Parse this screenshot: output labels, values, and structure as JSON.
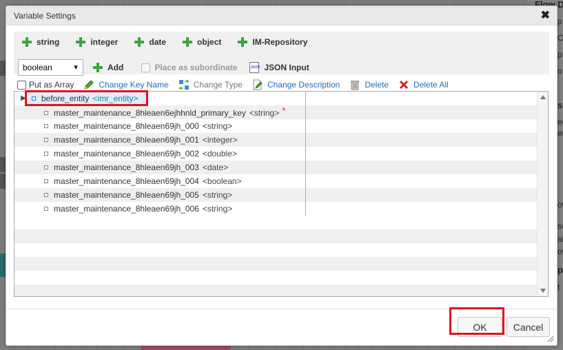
{
  "dialog": {
    "title": "Variable Settings",
    "close_symbol": "✖"
  },
  "toolbar": {
    "add_buttons": [
      {
        "label": "string",
        "icon": "plus-icon"
      },
      {
        "label": "integer",
        "icon": "plus-icon"
      },
      {
        "label": "date",
        "icon": "plus-icon"
      },
      {
        "label": "object",
        "icon": "plus-icon"
      },
      {
        "label": "IM-Repository",
        "icon": "plus-icon"
      }
    ],
    "type_select": {
      "value": "boolean"
    },
    "add_label": "Add",
    "place_subordinate_label": "Place as subordinate",
    "json_input_label": "JSON Input",
    "json_icon_text": "JSON"
  },
  "actions": {
    "put_as_array": "Put as Array",
    "change_key_name": "Change Key Name",
    "change_type": "Change Type",
    "change_description": "Change Description",
    "delete": "Delete",
    "delete_all": "Delete All"
  },
  "tree": {
    "root": {
      "name": "before_entity",
      "type": "<imr_entity>"
    },
    "children": [
      {
        "name": "master_maintenance_8hleaen6ejhhnld_primary_key",
        "type": "<string>",
        "required": "*"
      },
      {
        "name": "master_maintenance_8hleaen69jh_000",
        "type": "<string>"
      },
      {
        "name": "master_maintenance_8hleaen69jh_001",
        "type": "<integer>"
      },
      {
        "name": "master_maintenance_8hleaen69jh_002",
        "type": "<double>"
      },
      {
        "name": "master_maintenance_8hleaen69jh_003",
        "type": "<date>"
      },
      {
        "name": "master_maintenance_8hleaen69jh_004",
        "type": "<boolean>"
      },
      {
        "name": "master_maintenance_8hleaen69jh_005",
        "type": "<string>"
      },
      {
        "name": "master_maintenance_8hleaen69jh_006",
        "type": "<string>"
      }
    ]
  },
  "footer": {
    "ok_label": "OK",
    "cancel_label": "Cancel"
  },
  "background": {
    "top_right_title": "Flow D",
    "fragments": [
      "p",
      "C",
      "p",
      "o",
      "s",
      "ed",
      "en",
      "ow",
      "se",
      "ali",
      "ow",
      "pi",
      "t"
    ],
    "left_fragments": [
      "it",
      "p",
      "at",
      "n_"
    ]
  },
  "colors": {
    "plus_icon": "#3aa63a",
    "link": "#1a6fbf",
    "highlight_box": "#e0141e",
    "root_type": "#1f7ea0"
  }
}
